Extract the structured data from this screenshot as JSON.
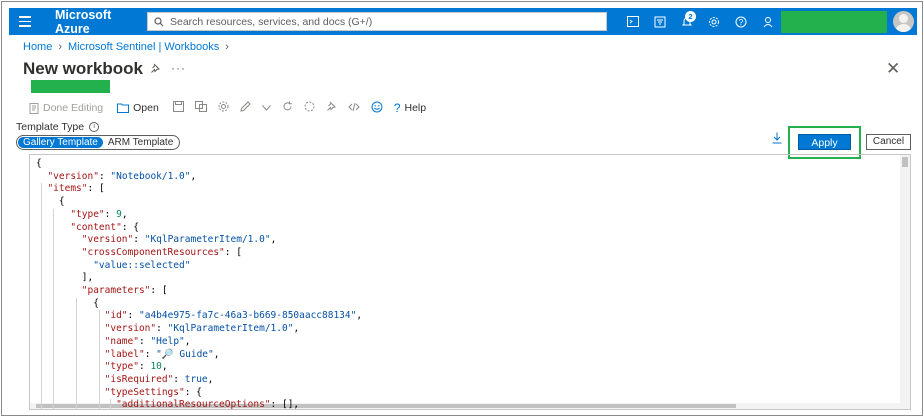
{
  "topbar": {
    "brand": "Microsoft Azure",
    "search_placeholder": "Search resources, services, and docs (G+/)",
    "notification_count": "2",
    "accent_color": "#0078d4"
  },
  "breadcrumb": {
    "items": [
      "Home",
      "Microsoft Sentinel | Workbooks"
    ]
  },
  "page": {
    "title": "New workbook"
  },
  "toolbar": {
    "done_editing": "Done Editing",
    "open": "Open",
    "help": "Help"
  },
  "template_type": {
    "label": "Template Type",
    "options": [
      "Gallery Template",
      "ARM Template"
    ],
    "selected": "Gallery Template"
  },
  "actions": {
    "apply": "Apply",
    "cancel": "Cancel"
  },
  "editor": {
    "lines": [
      "{",
      "  \"version\": \"Notebook/1.0\",",
      "  \"items\": [",
      "    {",
      "      \"type\": 9,",
      "      \"content\": {",
      "        \"version\": \"KqlParameterItem/1.0\",",
      "        \"crossComponentResources\": [",
      "          \"value::selected\"",
      "        ],",
      "        \"parameters\": [",
      "          {",
      "            \"id\": \"a4b4e975-fa7c-46a3-b669-850aacc88134\",",
      "            \"version\": \"KqlParameterItem/1.0\",",
      "            \"name\": \"Help\",",
      "            \"label\": \"🔎 Guide\",",
      "            \"type\": 10,",
      "            \"isRequired\": true,",
      "            \"typeSettings\": {",
      "              \"additionalResourceOptions\": [],"
    ]
  }
}
